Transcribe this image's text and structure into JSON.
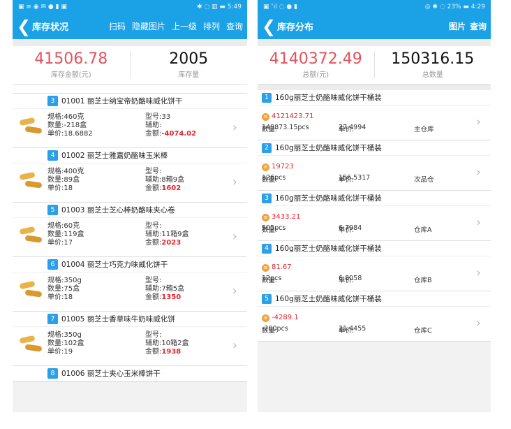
{
  "left": {
    "status": {
      "left": "▣ ≡ ◉ ✉ ● ▮ ▣",
      "right": "✱ ◌ ▥ ▬ 5:49"
    },
    "title": "库存状况",
    "actions": [
      "扫码",
      "隐藏图片",
      "上一级",
      "排列",
      "查询"
    ],
    "summary": {
      "amount": "41506.78",
      "amount_label": "库存金额(元)",
      "qty": "2005",
      "qty_label": "库存量"
    },
    "labels": {
      "spec": "规格:",
      "model": "型号:",
      "qty": "数量:",
      "aux": "辅助:",
      "price": "单价:",
      "amount": "金额:"
    },
    "items": [
      {
        "no": "3",
        "name": "01001 丽芝士纳宝帝奶酪味威化饼干",
        "spec": "460克",
        "model": "33",
        "qty": "-218盒",
        "aux": "",
        "price": "18.6882",
        "amount": "-4074.02"
      },
      {
        "no": "4",
        "name": "01002 丽芝士雅嘉奶酪味玉米棒",
        "spec": "400克",
        "model": "",
        "qty": "89盒",
        "aux": "8箱9盒",
        "price": "18",
        "amount": "1602"
      },
      {
        "no": "5",
        "name": "01003 丽芝士芝心棒奶酪味夹心卷",
        "spec": "60克",
        "model": "",
        "qty": "119盒",
        "aux": "11箱9盒",
        "price": "17",
        "amount": "2023"
      },
      {
        "no": "6",
        "name": "01004 丽芝士巧克力味威化饼干",
        "spec": "350g",
        "model": "",
        "qty": "75盒",
        "aux": "7箱5盒",
        "price": "18",
        "amount": "1350"
      },
      {
        "no": "7",
        "name": "01005 丽芝士香草味牛奶味威化饼",
        "spec": "350g",
        "model": "",
        "qty": "102盒",
        "aux": "10箱2盒",
        "price": "19",
        "amount": "1938"
      },
      {
        "no": "8",
        "name": "01006 丽芝士夹心玉米棒饼干"
      }
    ]
  },
  "right": {
    "status": {
      "left": "▣ ″ıl ◌ ● ▮",
      "right": "◎ ✱ ◌ 23% ▬ 4:29"
    },
    "title": "库存分布",
    "actions": [
      "图片",
      "查询"
    ],
    "summary": {
      "amount": "4140372.49",
      "amount_label": "总额(元)",
      "qty": "150316.15",
      "qty_label": "总数量"
    },
    "labels": {
      "qty": "数量:",
      "price": "单价:"
    },
    "items": [
      {
        "no": "1",
        "name": "160g丽芝士奶酪味威化饼干桶装",
        "amount": "4121423.71",
        "qty": "149873.15pcs",
        "price": "27.4994",
        "warehouse": "主仓库"
      },
      {
        "no": "2",
        "name": "160g丽芝士奶酪味威化饼干桶装",
        "amount": "19723",
        "qty": "126pcs",
        "price": "156.5317",
        "warehouse": "次品仓"
      },
      {
        "no": "3",
        "name": "160g丽芝士奶酪味威化饼干桶装",
        "amount": "3433.21",
        "qty": "505pcs",
        "price": "6.7984",
        "warehouse": "仓库A"
      },
      {
        "no": "4",
        "name": "160g丽芝士奶酪味威化饼干桶装",
        "amount": "81.67",
        "qty": "12pcs",
        "price": "6.8058",
        "warehouse": "仓库B"
      },
      {
        "no": "5",
        "name": "160g丽芝士奶酪味威化饼干桶装",
        "amount": "-4289.1",
        "qty": "-200pcs",
        "price": "21.4455",
        "warehouse": "仓库C"
      }
    ]
  }
}
